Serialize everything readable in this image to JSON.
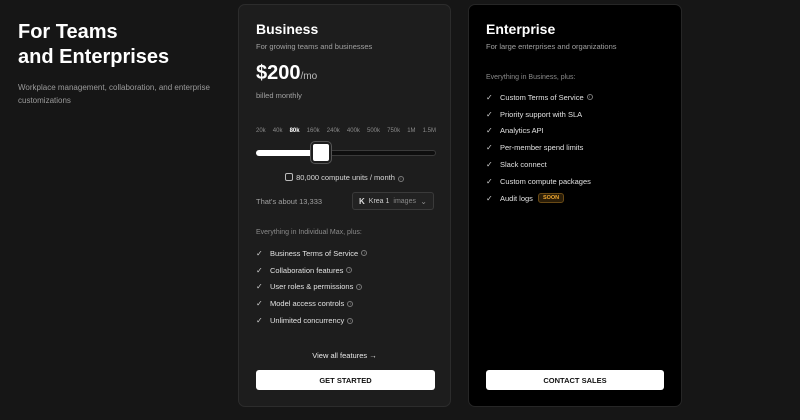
{
  "intro": {
    "title_line1": "For Teams",
    "title_line2": "and Enterprises",
    "description": "Workplace management, collaboration, and enterprise customizations"
  },
  "business": {
    "title": "Business",
    "subtitle": "For growing teams and businesses",
    "price": "$200",
    "price_unit": "/mo",
    "billing": "billed monthly",
    "ticks": [
      "20k",
      "40k",
      "80k",
      "160k",
      "240k",
      "400k",
      "500k",
      "750k",
      "1M",
      "1.5M"
    ],
    "selected_tick": "80k",
    "slider_fraction": 0.25,
    "compute": "80,000 compute units / month",
    "about": "That's about 13,333",
    "model_icon": "K",
    "model_name": "Krea 1",
    "model_unit": "images",
    "features_label": "Everything in Individual Max, plus:",
    "features": [
      "Business Terms of Service",
      "Collaboration features",
      "User roles & permissions",
      "Model access controls",
      "Unlimited concurrency"
    ],
    "view_all": "View all features →",
    "cta": "GET STARTED"
  },
  "enterprise": {
    "title": "Enterprise",
    "subtitle": "For large enterprises and organizations",
    "features_label": "Everything in Business, plus:",
    "features": [
      "Custom Terms of Service",
      "Priority support with SLA",
      "Analytics API",
      "Per-member spend limits",
      "Slack connect",
      "Custom compute packages",
      "Audit logs"
    ],
    "soon_badge": "SOON",
    "cta": "CONTACT SALES"
  },
  "icons": {
    "check": "check-icon",
    "info": "info-icon",
    "cpu": "cpu-icon",
    "chevron": "chevron-down-icon",
    "arrow": "arrow-right-icon"
  },
  "colors": {
    "background": "#161616",
    "business_card": "#1d1d1d",
    "enterprise_card": "#000000",
    "soon_badge": "#f0a830"
  }
}
